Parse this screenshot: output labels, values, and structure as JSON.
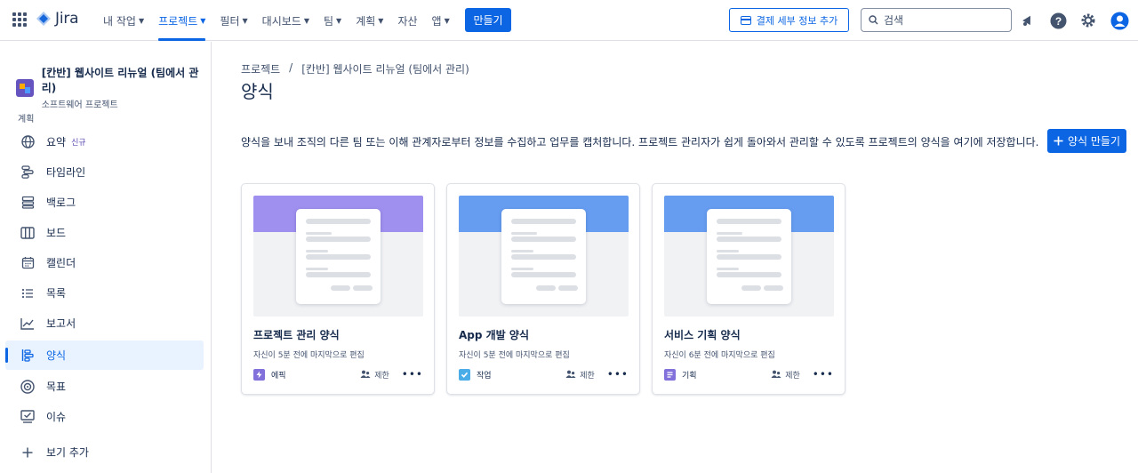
{
  "topbar": {
    "logo_text": "Jira",
    "nav": [
      {
        "label": "내 작업",
        "dropdown": true
      },
      {
        "label": "프로젝트",
        "dropdown": true,
        "active": true
      },
      {
        "label": "필터",
        "dropdown": true
      },
      {
        "label": "대시보드",
        "dropdown": true
      },
      {
        "label": "팀",
        "dropdown": true
      },
      {
        "label": "계획",
        "dropdown": true
      },
      {
        "label": "자산",
        "dropdown": false
      },
      {
        "label": "앱",
        "dropdown": true
      }
    ],
    "create_label": "만들기",
    "billing_label": "결제 세부 정보 추가",
    "search_placeholder": "검색",
    "icons": [
      "notifications-icon",
      "help-icon",
      "settings-icon",
      "profile-icon"
    ],
    "accent": "#0C66E4"
  },
  "sidebar": {
    "project_name": "[칸반] 웹사이트 리뉴얼 (팀에서 관리)",
    "project_type": "소프트웨어 프로젝트",
    "section": "계획",
    "items": [
      {
        "label": "요약",
        "icon": "globe-icon",
        "badge": "신규"
      },
      {
        "label": "타임라인",
        "icon": "timeline-icon"
      },
      {
        "label": "백로그",
        "icon": "backlog-icon"
      },
      {
        "label": "보드",
        "icon": "board-icon"
      },
      {
        "label": "캘린더",
        "icon": "calendar-icon"
      },
      {
        "label": "목록",
        "icon": "list-icon"
      },
      {
        "label": "보고서",
        "icon": "reports-icon"
      },
      {
        "label": "양식",
        "icon": "forms-icon",
        "active": true
      },
      {
        "label": "목표",
        "icon": "goals-icon"
      },
      {
        "label": "이슈",
        "icon": "issues-icon"
      }
    ],
    "add_view": "보기 추가"
  },
  "main": {
    "breadcrumb": [
      "프로젝트",
      "[칸반] 웹사이트 리뉴얼 (팀에서 관리)"
    ],
    "breadcrumb_sep": "/",
    "title": "양식",
    "description": "양식을 보내 조직의 다른 팀 또는 이해 관계자로부터 정보를 수집하고 업무를 캡처합니다. 프로젝트 관리자가 쉽게 돌아와서 관리할 수 있도록 프로젝트의 양식을 여기에 저장합니다.",
    "create_form_label": "양식 만들기"
  },
  "cards": [
    {
      "title": "프로젝트 관리 양식",
      "subtitle": "자신이 5분 전에 마지막으로 편집",
      "type": "에픽",
      "type_color": "#8270DB",
      "band_color": "#9F8FEF",
      "restriction": "제한"
    },
    {
      "title": "App 개발 양식",
      "subtitle": "자신이 5분 전에 마지막으로 편집",
      "type": "작업",
      "type_color": "#4BADE8",
      "band_color": "#669DF1",
      "restriction": "제한"
    },
    {
      "title": "서비스 기획 양식",
      "subtitle": "자신이 6분 전에 마지막으로 편집",
      "type": "기획",
      "type_color": "#8270DB",
      "band_color": "#669DF1",
      "restriction": "제한"
    }
  ]
}
